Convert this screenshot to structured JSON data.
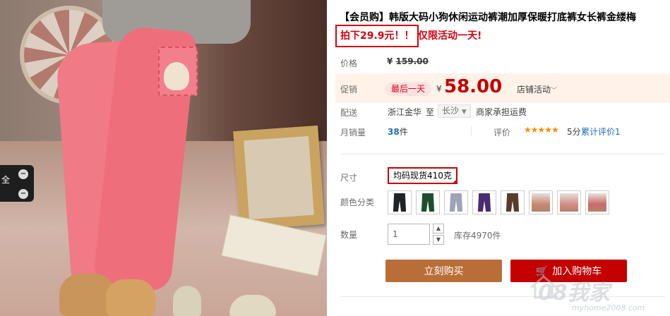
{
  "side_tab": {
    "label": "全"
  },
  "product": {
    "title": "【会员购】韩版大码小狗休闲运动裤潮加厚保暖打底裤女长裤金缕梅",
    "promo_price_text": "拍下29.9元！！",
    "promo_note": "仅限活动一天!"
  },
  "price_row": {
    "label": "价格",
    "currency": "¥",
    "original_price": "159.00"
  },
  "promo_row": {
    "label": "促销",
    "badge": "最后一天",
    "currency": "¥",
    "price": "58.00",
    "activity": "店铺活动"
  },
  "shipping_row": {
    "label": "配送",
    "from": "浙江金华",
    "to_word": "至",
    "city": "长沙",
    "fee": "商家承担运费"
  },
  "sales_row": {
    "label": "月销量",
    "count": "38",
    "unit": "件",
    "review_label": "评价",
    "stars": "★★★★★",
    "score": "5分",
    "cumulative": "累计评价1"
  },
  "size_row": {
    "label": "尺寸",
    "selected": "均码现货410克"
  },
  "color_row": {
    "label": "颜色分类",
    "swatches": [
      {
        "name": "black",
        "color": "#1f2226"
      },
      {
        "name": "green",
        "color": "#1d4f2e"
      },
      {
        "name": "gray",
        "color": "#9ea3b8"
      },
      {
        "name": "purple",
        "color": "#4a2a72"
      },
      {
        "name": "brown",
        "color": "#5a3a2a"
      },
      {
        "name": "photo1",
        "color": "#c98870"
      },
      {
        "name": "photo2",
        "color": "#d38c84"
      },
      {
        "name": "photo3",
        "color": "#c96a6a"
      }
    ]
  },
  "qty_row": {
    "label": "数量",
    "value": "1",
    "stock": "库存4970件"
  },
  "actions": {
    "buy_now": "立刻购买",
    "add_to_cart": "加入购物车"
  },
  "watermark": {
    "logo": "08我家",
    "url": "myhome2008.com"
  }
}
